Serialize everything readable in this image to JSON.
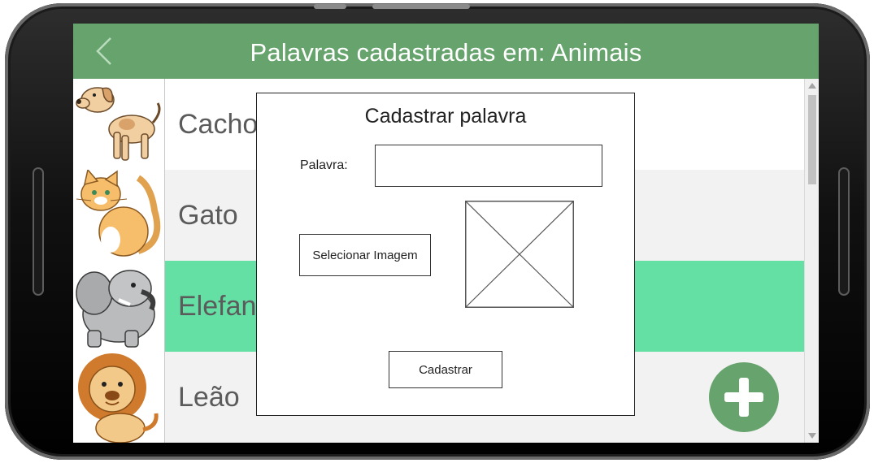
{
  "appbar": {
    "title": "Palavras cadastradas em: Animais",
    "back_icon": "chevron-left-icon",
    "color": "#67a46d"
  },
  "list": {
    "items": [
      {
        "label": "Cacho",
        "image": "dog-illustration",
        "selected": false,
        "bg": "#ffffff"
      },
      {
        "label": "Gato",
        "image": "cat-illustration",
        "selected": false,
        "bg": "#f2f2f2"
      },
      {
        "label": "Elefan",
        "image": "elephant-illustration",
        "selected": true,
        "bg": "#64e0a5"
      },
      {
        "label": "Leão",
        "image": "lion-illustration",
        "selected": false,
        "bg": "#f2f2f2"
      }
    ]
  },
  "fab": {
    "icon": "plus-icon",
    "color": "#67a46d"
  },
  "dialog": {
    "title": "Cadastrar palavra",
    "word_label": "Palavra:",
    "word_value": "",
    "select_image_label": "Selecionar Imagem",
    "image_placeholder_icon": "image-placeholder-icon",
    "submit_label": "Cadastrar"
  }
}
